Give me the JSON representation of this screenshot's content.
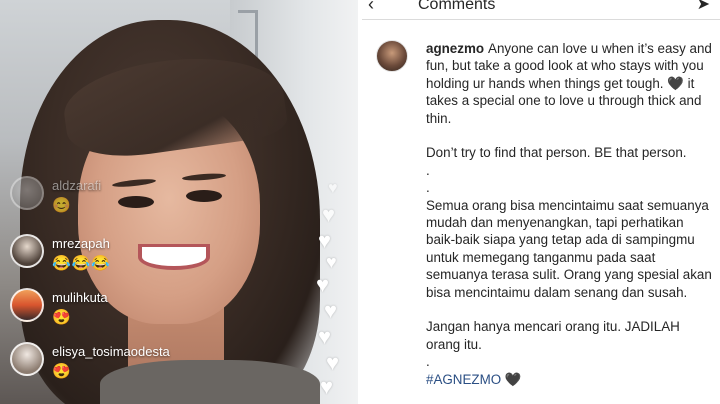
{
  "live": {
    "comments": [
      {
        "username": "aldzarafi",
        "emoji": "😊",
        "faded": true
      },
      {
        "username": "mrezapah",
        "emoji": "😂😂😂",
        "faded": false
      },
      {
        "username": "mulihkuta",
        "emoji": "😍",
        "faded": false
      },
      {
        "username": "elisya_tosimaodesta",
        "emoji": "😍",
        "faded": false
      }
    ],
    "heart_glyph": "♥"
  },
  "comments_panel": {
    "back_glyph": "‹",
    "title": "Comments",
    "share_glyph": "➤",
    "post": {
      "username": "agnezmo",
      "line_1": "Anyone can love u when it’s easy and fun, but take a good look at who stays with you holding ur hands when things get tough. 🖤 it takes a special one to love u through thick and thin.",
      "line_2": "Don’t try to find that person. BE that person.",
      "dot_1": ".",
      "dot_2": ".",
      "line_3": "Semua orang bisa mencintaimu saat semuanya mudah dan menyenangkan, tapi perhatikan baik-baik siapa yang tetap ada di sampingmu untuk memegang tanganmu pada saat semuanya terasa sulit. Orang yang spesial akan bisa mencintaimu dalam senang dan susah.",
      "line_4": "Jangan hanya mencari orang itu. JADILAH orang itu.",
      "dot_3": ".",
      "hashtag": "#AGNEZMO 🖤"
    }
  }
}
